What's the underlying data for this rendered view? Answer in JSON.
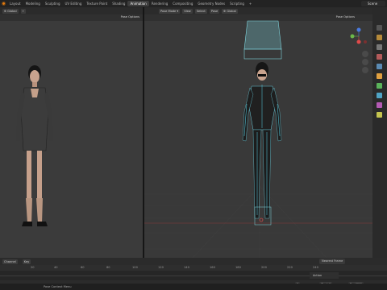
{
  "topbar": {
    "tabs": [
      "Layout",
      "Modeling",
      "Sculpting",
      "UV Editing",
      "Texture Paint",
      "Shading",
      "Animation",
      "Rendering",
      "Compositing",
      "Geometry Nodes",
      "Scripting",
      "+"
    ],
    "active_tab": "Animation",
    "scene": "Scene"
  },
  "left_view": {
    "header": {
      "orientation": "Global"
    },
    "pose_options": "Pose Options"
  },
  "right_view": {
    "header": {
      "mode": "Pose Mode",
      "menus": [
        "View",
        "Select",
        "Pose"
      ],
      "orientation": "Global"
    },
    "pose_options": "Pose Options",
    "overlay": {
      "line1": "Camera Perspective",
      "line2": "(1) Armature : Sunglasses"
    }
  },
  "timeline": {
    "menus": [
      "Channel",
      "Key"
    ],
    "ticks": [
      "20",
      "40",
      "60",
      "80",
      "100",
      "120",
      "140",
      "160",
      "180",
      "200",
      "220",
      "240"
    ],
    "interpolation": "Nearest Frame",
    "action_label": "Action",
    "current_frame": "1",
    "start_label": "Start",
    "start_value": "1",
    "end_label": "End",
    "end_value": "250"
  },
  "status": {
    "text": "Pose Context Menu"
  },
  "colors": {
    "accent": "#e87d0d",
    "active_tab": "#3d3d3d",
    "bone_cyan": "#66c6d6",
    "header": "#2b2b2b"
  }
}
